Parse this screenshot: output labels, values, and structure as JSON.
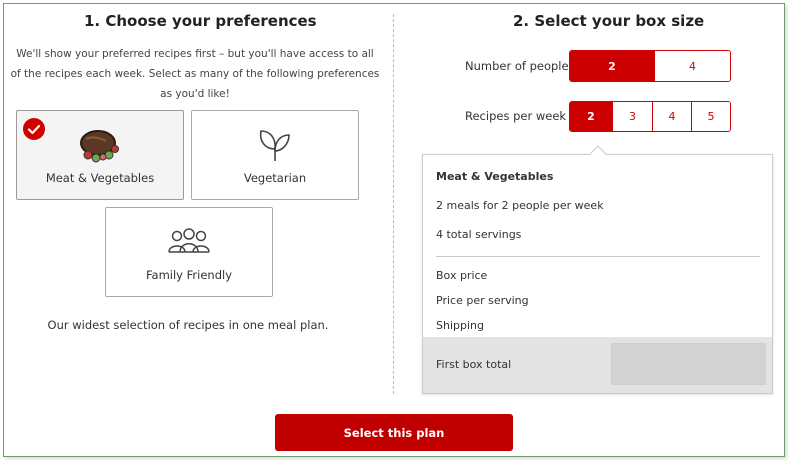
{
  "left": {
    "title": "1. Choose your preferences",
    "intro": "We'll show your preferred recipes first – but you'll have access to all of the recipes each week. Select as many of the following preferences as you'd like!",
    "preferences": [
      {
        "label": "Meat & Vegetables",
        "icon": "meat-vegetables-icon",
        "selected": true
      },
      {
        "label": "Vegetarian",
        "icon": "leaf-icon",
        "selected": false
      },
      {
        "label": "Family Friendly",
        "icon": "family-icon",
        "selected": false
      }
    ],
    "tagline": "Our widest selection of recipes in one meal plan."
  },
  "right": {
    "title": "2. Select your box size",
    "people": {
      "label": "Number of people",
      "options": [
        "2",
        "4"
      ],
      "selected": "2"
    },
    "recipes": {
      "label": "Recipes per week",
      "options": [
        "2",
        "3",
        "4",
        "5"
      ],
      "selected": "2"
    },
    "summary": {
      "plan_name": "Meat & Vegetables",
      "meals_line": "2 meals for 2 people per week",
      "servings_line": "4 total servings",
      "box_price_label": "Box price",
      "price_per_serving_label": "Price per serving",
      "shipping_label": "Shipping",
      "first_box_total_label": "First box total"
    }
  },
  "cta": {
    "label": "Select this plan"
  },
  "colors": {
    "accent": "#c00000",
    "border": "#aaaaaa",
    "frame": "#6f9d6f"
  }
}
